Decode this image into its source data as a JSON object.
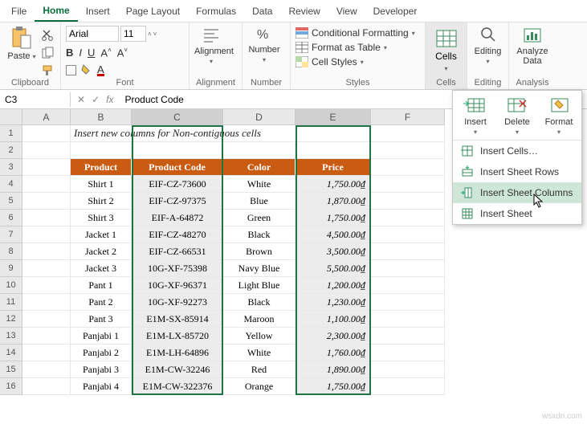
{
  "menubar": [
    "File",
    "Home",
    "Insert",
    "Page Layout",
    "Formulas",
    "Data",
    "Review",
    "View",
    "Developer"
  ],
  "active_tab": "Home",
  "groups": {
    "clipboard": {
      "label": "Clipboard",
      "paste": "Paste"
    },
    "font": {
      "label": "Font",
      "name": "Arial",
      "size": "11",
      "bold": "B",
      "italic": "I",
      "underline": "U",
      "grow": "A^",
      "shrink": "A˅",
      "fontcolor": "A"
    },
    "alignment": {
      "label": "Alignment",
      "btn": "Alignment"
    },
    "number": {
      "label": "Number",
      "btn": "Number"
    },
    "styles": {
      "label": "Styles",
      "cond": "Conditional Formatting",
      "table": "Format as Table",
      "cell": "Cell Styles"
    },
    "cells": {
      "label": "Cells",
      "btn": "Cells"
    },
    "editing": {
      "label": "Editing",
      "btn": "Editing"
    },
    "analysis": {
      "label": "Analysis",
      "btn": "Analyze Data"
    }
  },
  "namebox": "C3",
  "formula": "Product Code",
  "columns": [
    "A",
    "B",
    "C",
    "D",
    "E",
    "F"
  ],
  "title_text": "Insert new columns for Non-contiguous cells",
  "headers": {
    "b": "Product",
    "c": "Product Code",
    "d": "Color",
    "e": "Price"
  },
  "rows": [
    {
      "b": "Shirt 1",
      "c": "EIF-CZ-73600",
      "d": "White",
      "e": "1,750.00₫"
    },
    {
      "b": "Shirt 2",
      "c": "EIF-CZ-97375",
      "d": "Blue",
      "e": "1,870.00₫"
    },
    {
      "b": "Shirt 3",
      "c": "EIF-A-64872",
      "d": "Green",
      "e": "1,750.00₫"
    },
    {
      "b": "Jacket 1",
      "c": "EIF-CZ-48270",
      "d": "Black",
      "e": "4,500.00₫"
    },
    {
      "b": "Jacket 2",
      "c": "EIF-CZ-66531",
      "d": "Brown",
      "e": "3,500.00₫"
    },
    {
      "b": "Jacket 3",
      "c": "10G-XF-75398",
      "d": "Navy Blue",
      "e": "5,500.00₫"
    },
    {
      "b": "Pant 1",
      "c": "10G-XF-96371",
      "d": "Light Blue",
      "e": "1,200.00₫"
    },
    {
      "b": "Pant 2",
      "c": "10G-XF-92273",
      "d": "Black",
      "e": "1,230.00₫"
    },
    {
      "b": "Pant 3",
      "c": "E1M-SX-85914",
      "d": "Maroon",
      "e": "1,100.00₫"
    },
    {
      "b": "Panjabi 1",
      "c": "E1M-LX-85720",
      "d": "Yellow",
      "e": "2,300.00₫"
    },
    {
      "b": "Panjabi 2",
      "c": "E1M-LH-64896",
      "d": "White",
      "e": "1,760.00₫"
    },
    {
      "b": "Panjabi 3",
      "c": "E1M-CW-32246",
      "d": "Red",
      "e": "1,890.00₫"
    },
    {
      "b": "Panjabi 4",
      "c": "E1M-CW-322376",
      "d": "Orange",
      "e": "1,750.00₫"
    }
  ],
  "dropdown": {
    "insert": "Insert",
    "delete": "Delete",
    "format": "Format",
    "cells": "Insert Cells…",
    "sheet_rows": "Insert Sheet Rows",
    "sheet_cols": "Insert Sheet Columns",
    "sheet": "Insert Sheet"
  },
  "watermark": "wsxdn.com"
}
